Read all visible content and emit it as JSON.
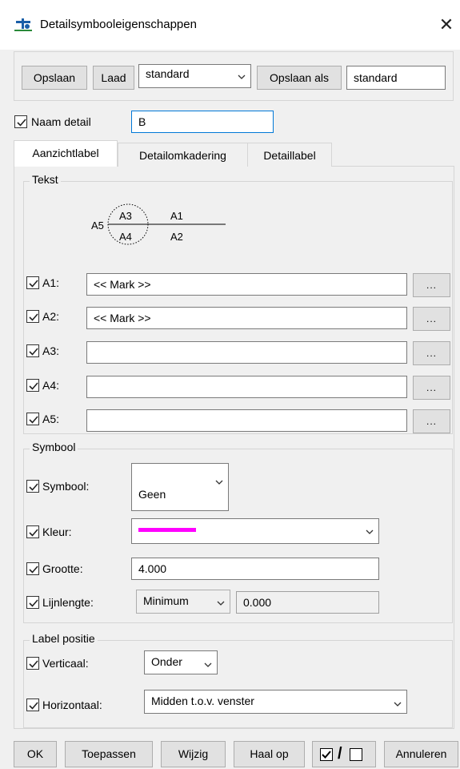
{
  "window": {
    "title": "Detailsymbooleigenschappen",
    "close_glyph": "✕",
    "icon": "detail-symbol-icon"
  },
  "toolbar": {
    "save_label": "Opslaan",
    "load_label": "Laad",
    "preset_value": "standard",
    "save_as_label": "Opslaan als",
    "save_as_value": "standard"
  },
  "name_detail": {
    "label": "Naam detail",
    "value": "B",
    "checked": true
  },
  "tabs": [
    {
      "label": "Aanzichtlabel",
      "active": true
    },
    {
      "label": "Detailomkadering",
      "active": false
    },
    {
      "label": "Detaillabel",
      "active": false
    }
  ],
  "text_group": {
    "legend": "Tekst",
    "diagram": {
      "a1": "A1",
      "a2": "A2",
      "a3": "A3",
      "a4": "A4",
      "a5": "A5"
    },
    "rows": [
      {
        "label": "A1:",
        "value": "<< Mark >>",
        "checked": true,
        "browse": "..."
      },
      {
        "label": "A2:",
        "value": "<< Mark >>",
        "checked": true,
        "browse": "..."
      },
      {
        "label": "A3:",
        "value": "",
        "checked": true,
        "browse": "..."
      },
      {
        "label": "A4:",
        "value": "",
        "checked": true,
        "browse": "..."
      },
      {
        "label": "A5:",
        "value": "",
        "checked": true,
        "browse": "..."
      }
    ]
  },
  "symbol_group": {
    "legend": "Symbool",
    "symbol_label": "Symbool:",
    "symbol_value": "Geen",
    "color_label": "Kleur:",
    "color_value": "#ff00ff",
    "size_label": "Grootte:",
    "size_value": "4.000",
    "line_label": "Lijnlengte:",
    "line_mode": "Minimum",
    "line_value": "0.000"
  },
  "label_position_group": {
    "legend": "Label positie",
    "vertical_label": "Verticaal:",
    "vertical_value": "Onder",
    "horizontal_label": "Horizontaal:",
    "horizontal_value": "Midden t.o.v. venster"
  },
  "footer": {
    "ok": "OK",
    "apply": "Toepassen",
    "modify": "Wijzig",
    "get": "Haal op",
    "toggle_slash": "/",
    "cancel": "Annuleren"
  }
}
